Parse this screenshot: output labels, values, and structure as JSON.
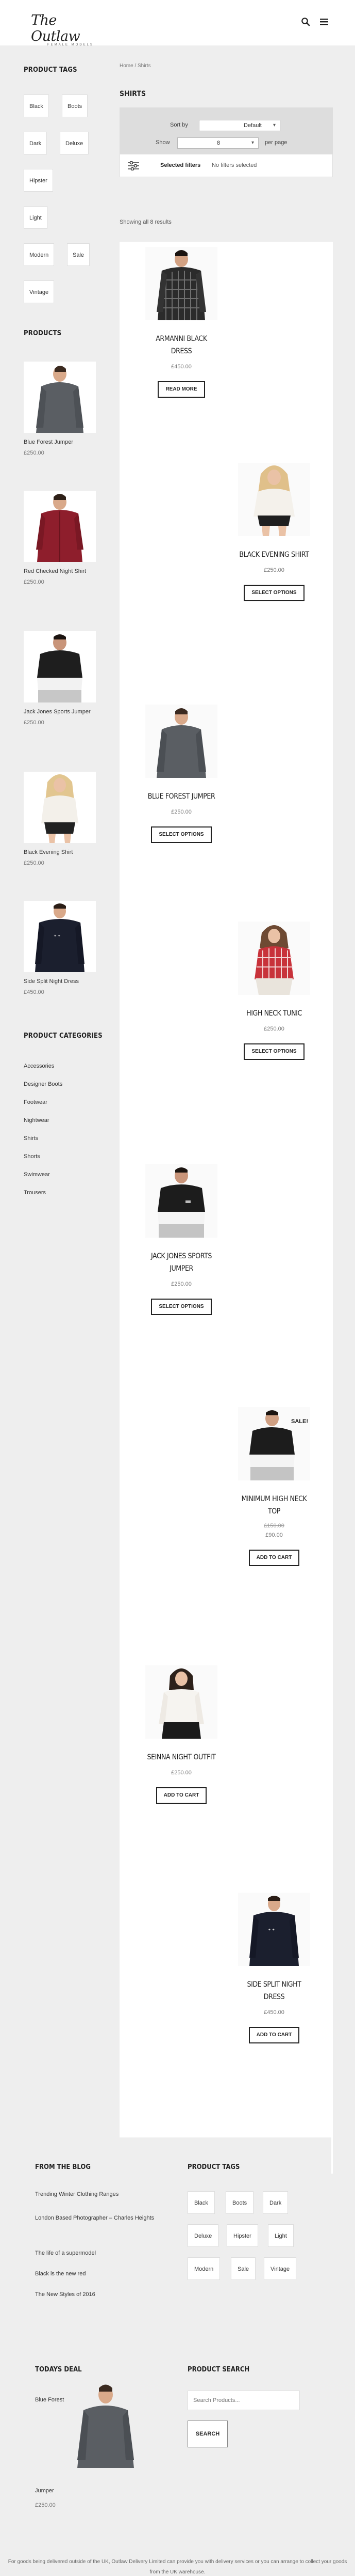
{
  "header": {
    "logo_main": "The Outlaw",
    "logo_sub": "FEMALE MODELS"
  },
  "sidebar": {
    "tags_heading": "PRODUCT TAGS",
    "tags": [
      "Black",
      "Boots",
      "Dark",
      "Deluxe",
      "Hipster",
      "Light",
      "Modern",
      "Sale",
      "Vintage"
    ],
    "products_heading": "PRODUCTS",
    "products": [
      {
        "name": "Blue Forest Jumper",
        "price": "£250.00"
      },
      {
        "name": "Red Checked Night Shirt",
        "price": "£250.00"
      },
      {
        "name": "Jack Jones Sports Jumper",
        "price": "£250.00"
      },
      {
        "name": "Black Evening Shirt",
        "price": "£250.00"
      },
      {
        "name": "Side Split Night Dress",
        "price": "£450.00"
      }
    ],
    "categories_heading": "PRODUCT CATEGORIES",
    "categories": [
      "Accessories",
      "Designer Boots",
      "Footwear",
      "Nightwear",
      "Shirts",
      "Shorts",
      "Swimwear",
      "Trousers"
    ]
  },
  "main": {
    "breadcrumb": "Home / Shirts",
    "title": "SHIRTS",
    "sort_label": "Sort by",
    "sort_value": "Default",
    "show_label": "Show",
    "show_value": "8",
    "per_page": "per page",
    "selected_filters_label": "Selected filters",
    "selected_filters_value": "No filters selected",
    "showing": "Showing all 8 results",
    "products": [
      {
        "name": "ARMANNI BLACK DRESS",
        "price": "£450.00",
        "button": "READ MORE"
      },
      {
        "name": "BLACK EVENING SHIRT",
        "price": "£250.00",
        "button": "SELECT OPTIONS"
      },
      {
        "name": "BLUE FOREST JUMPER",
        "price": "£250.00",
        "button": "SELECT OPTIONS"
      },
      {
        "name": "HIGH NECK TUNIC",
        "price": "£250.00",
        "button": "SELECT OPTIONS"
      },
      {
        "name": "JACK JONES SPORTS JUMPER",
        "price": "£250.00",
        "button": "SELECT OPTIONS"
      },
      {
        "name": "MINIMUM HIGH NECK TOP",
        "old_price": "£150.00",
        "price": "£90.00",
        "button": "ADD TO CART",
        "badge": "SALE!"
      },
      {
        "name": "SEINNA NIGHT OUTFIT",
        "price": "£250.00",
        "button": "ADD TO CART"
      },
      {
        "name": "SIDE SPLIT NIGHT DRESS",
        "price": "£450.00",
        "button": "ADD TO CART"
      }
    ]
  },
  "footer": {
    "blog_heading": "FROM THE BLOG",
    "blog_posts": [
      "Trending Winter Clothing Ranges",
      "London Based Photographer – Charles Heights",
      "The life of a supermodel",
      "Black is the new red",
      "The New Styles of 2016"
    ],
    "tags_heading": "PRODUCT TAGS",
    "tags": [
      "Black",
      "Boots",
      "Dark",
      "Deluxe",
      "Hipster",
      "Light",
      "Modern",
      "Sale",
      "Vintage"
    ],
    "deal_heading": "TODAYS DEAL",
    "deal_name_top": "Blue Forest",
    "deal_name_bottom": "Jumper",
    "deal_price": "£250.00",
    "search_heading": "PRODUCT SEARCH",
    "search_placeholder": "Search Products...",
    "search_button": "SEARCH",
    "note": "For goods being delivered outside of the UK, Outlaw Delivery Limited can provide you with delivery services or you can arrange to collect your goods from the UK warehouse."
  },
  "colors": {
    "page_bg": "#eeeeee",
    "panel_bg": "#dddddd",
    "text_dark": "#222222",
    "accent_red": "#c0392b"
  },
  "icons": [
    "search-icon",
    "menu-icon",
    "filter-icon"
  ]
}
